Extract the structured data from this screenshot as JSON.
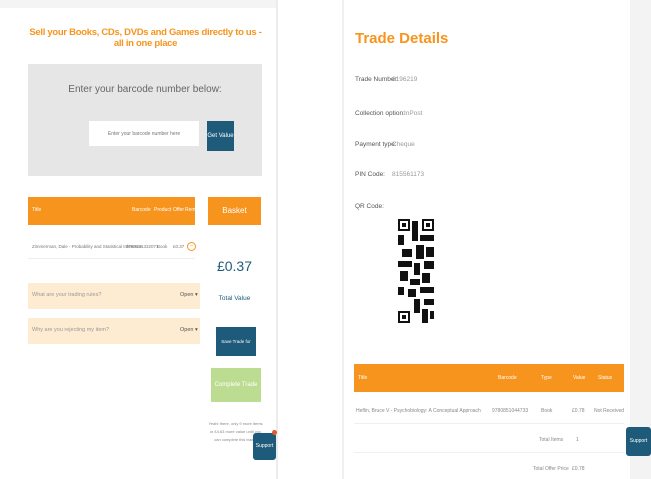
{
  "left": {
    "tagline": "Sell your Books, CDs, DVDs and Games directly to us - all in one place",
    "barcode_title": "Enter your barcode number below:",
    "barcode_placeholder": "Enter your barcode number here",
    "get_value_label": "Get Value",
    "table_headers": [
      "Title",
      "Barcode",
      "Product",
      "Offer",
      "Remove"
    ],
    "rows": [
      {
        "title": "Zimmerman, Dale - Probability and Statistical Inference",
        "barcode": "9780201332071",
        "product": "Book",
        "offer": "£0.37"
      }
    ],
    "accordion": [
      {
        "label": "What are your trading rules?",
        "state": "Open ▾"
      },
      {
        "label": "Why are you rejecting my item?",
        "state": "Open ▾"
      }
    ],
    "basket": {
      "title": "Basket",
      "total": "£0.37",
      "total_label": "Total Value",
      "save_label": "Save Trade for Later",
      "complete_label": "Complete Trade →",
      "note": "Yeah! there, only 9 more items or £4.63 more value until you can complete this trade."
    },
    "support_label": "Support"
  },
  "right": {
    "title": "Trade Details",
    "fields": [
      {
        "label": "Trade Number:",
        "value": "6196219"
      },
      {
        "label": "Collection option:",
        "value": "InPost"
      },
      {
        "label": "Payment type:",
        "value": "Cheque"
      },
      {
        "label": "PIN Code:",
        "value": "815561173"
      },
      {
        "label": "QR Code:",
        "value": ""
      }
    ],
    "table_headers": [
      "Title",
      "Barcode",
      "Type",
      "Value",
      "Status"
    ],
    "rows": [
      {
        "title": "Heflin, Bruce V - Psychobiology: A Conceptual Approach",
        "barcode": "9780851044733",
        "type": "Book",
        "value": "£0.78",
        "status": "Not Received"
      }
    ],
    "summary": [
      {
        "label": "Total Items",
        "value": "1"
      },
      {
        "label": "Total Offer Price",
        "value": "£0.78"
      }
    ],
    "support_label": "Support"
  },
  "colors": {
    "accent": "#f7941d",
    "primary": "#1e5b7a",
    "complete": "#bcdc92"
  }
}
